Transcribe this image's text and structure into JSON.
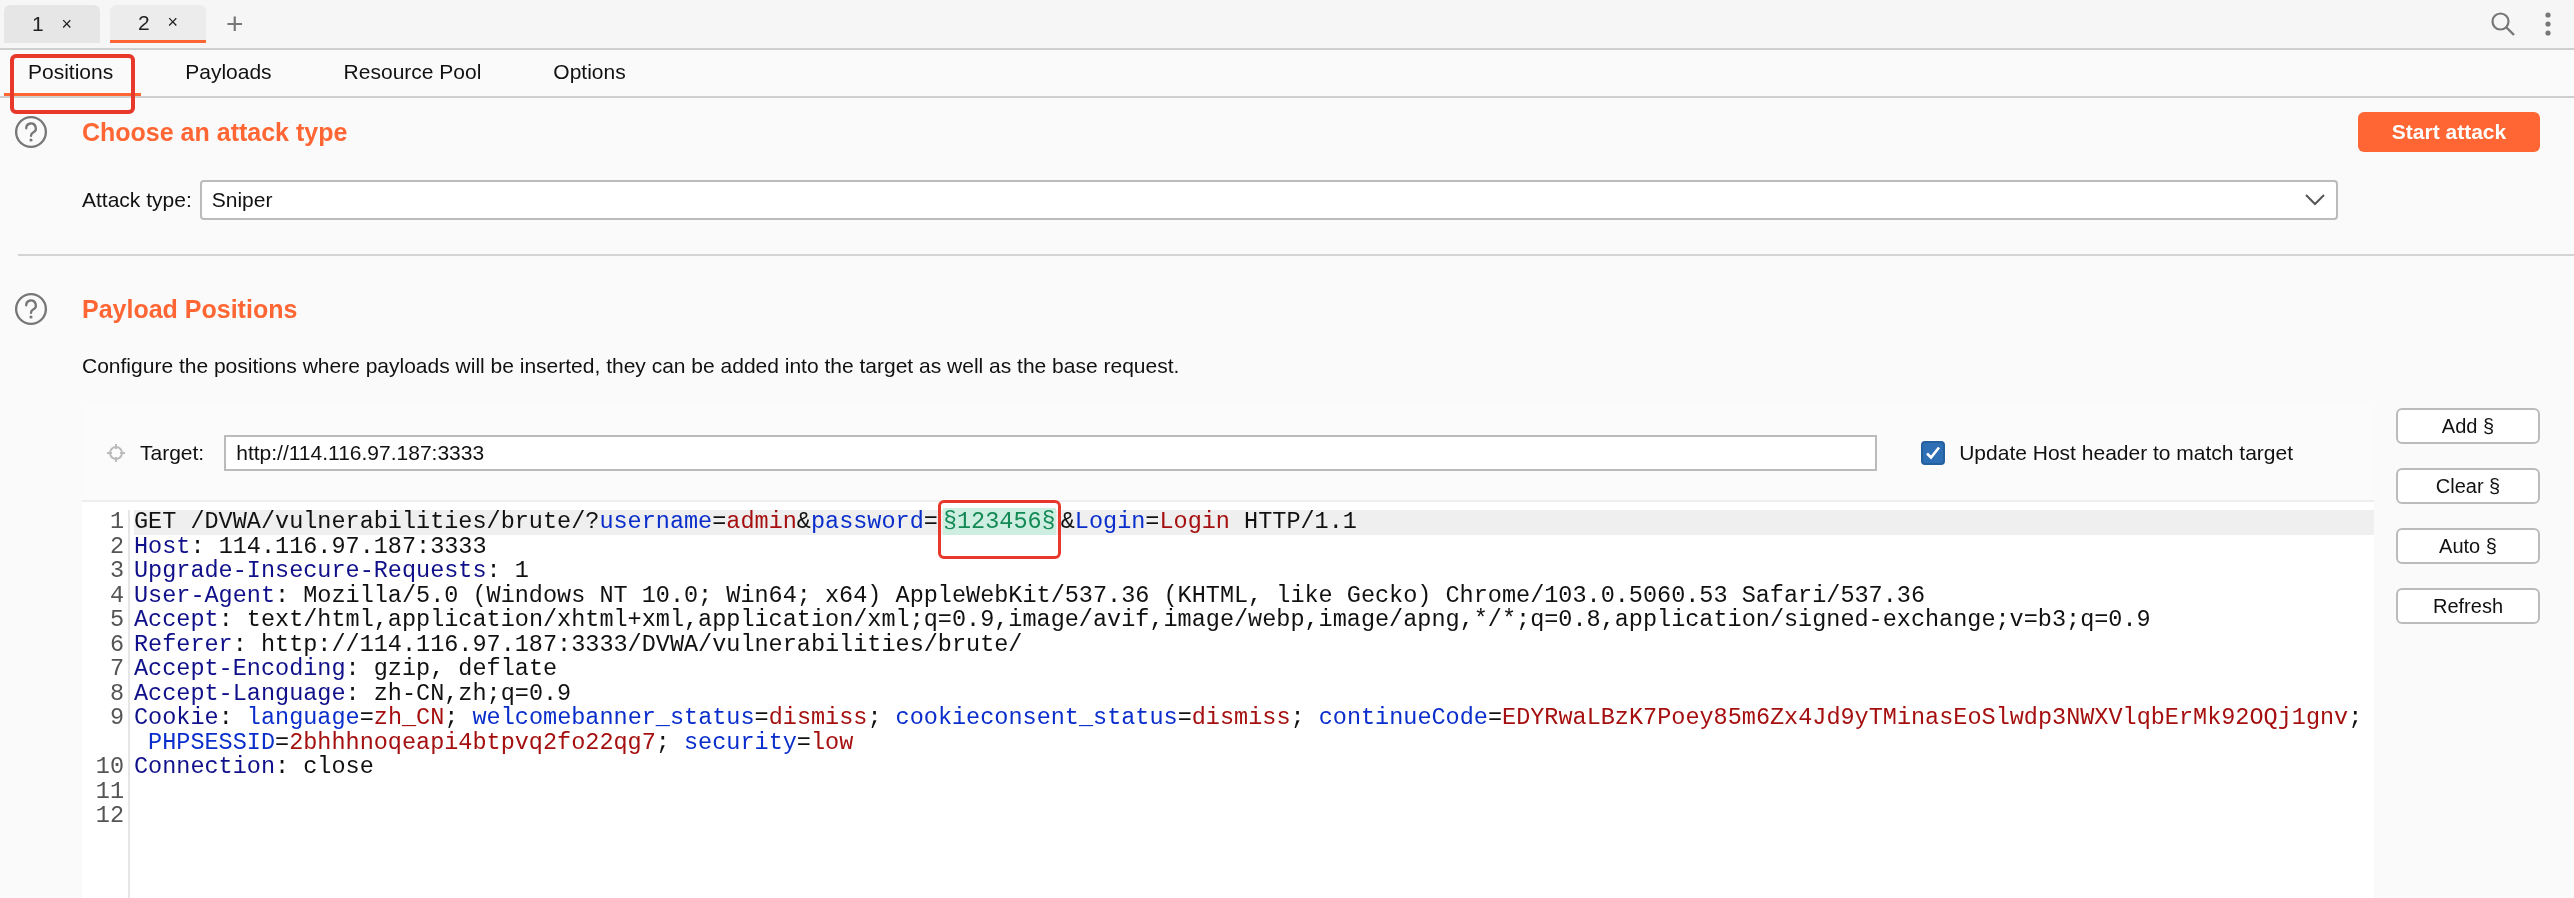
{
  "window_tabs": [
    {
      "label": "1",
      "close": "×",
      "selected": false
    },
    {
      "label": "2",
      "close": "×",
      "selected": true
    }
  ],
  "new_tab": "+",
  "subtabs": [
    {
      "label": "Positions",
      "selected": true,
      "annotated": true
    },
    {
      "label": "Payloads",
      "selected": false,
      "annotated": false
    },
    {
      "label": "Resource Pool",
      "selected": false,
      "annotated": false
    },
    {
      "label": "Options",
      "selected": false,
      "annotated": false
    }
  ],
  "attack_type": {
    "title": "Choose an attack type",
    "button": "Start attack",
    "field_label": "Attack type:",
    "value": "Sniper"
  },
  "payload_positions": {
    "title": "Payload Positions",
    "description": "Configure the positions where payloads will be inserted, they can be added into the target as well as the base request.",
    "target_label": "Target:",
    "target": "http://114.116.97.187:3333",
    "update_host": {
      "label": "Update Host header to match target",
      "checked": true
    },
    "request": {
      "lines": [
        {
          "number": "1",
          "current": true,
          "segments": [
            {
              "kind": "plain",
              "text": "GET /DVWA/vulnerabilities/brute/?"
            },
            {
              "kind": "param",
              "text": "username"
            },
            {
              "kind": "plain",
              "text": "="
            },
            {
              "kind": "value",
              "text": "admin"
            },
            {
              "kind": "plain",
              "text": "&"
            },
            {
              "kind": "param",
              "text": "password"
            },
            {
              "kind": "plain",
              "text": "="
            },
            {
              "kind": "marker",
              "text": "§123456§",
              "annotated": true
            },
            {
              "kind": "plain",
              "text": "&"
            },
            {
              "kind": "param",
              "text": "Login"
            },
            {
              "kind": "plain",
              "text": "="
            },
            {
              "kind": "value",
              "text": "Login"
            },
            {
              "kind": "plain",
              "text": " HTTP/1.1"
            }
          ]
        },
        {
          "number": "2",
          "current": false,
          "segments": [
            {
              "kind": "name",
              "text": "Host"
            },
            {
              "kind": "plain",
              "text": ": 114.116.97.187:3333"
            }
          ]
        },
        {
          "number": "3",
          "current": false,
          "segments": [
            {
              "kind": "name",
              "text": "Upgrade-Insecure-Requests"
            },
            {
              "kind": "plain",
              "text": ": 1"
            }
          ]
        },
        {
          "number": "4",
          "current": false,
          "segments": [
            {
              "kind": "name",
              "text": "User-Agent"
            },
            {
              "kind": "plain",
              "text": ": Mozilla/5.0 (Windows NT 10.0; Win64; x64) AppleWebKit/537.36 (KHTML, like Gecko) Chrome/103.0.5060.53 Safari/537.36"
            }
          ]
        },
        {
          "number": "5",
          "current": false,
          "segments": [
            {
              "kind": "name",
              "text": "Accept"
            },
            {
              "kind": "plain",
              "text": ": text/html,application/xhtml+xml,application/xml;q=0.9,image/avif,image/webp,image/apng,*/*;q=0.8,application/signed-exchange;v=b3;q=0.9"
            }
          ]
        },
        {
          "number": "6",
          "current": false,
          "segments": [
            {
              "kind": "name",
              "text": "Referer"
            },
            {
              "kind": "plain",
              "text": ": http://114.116.97.187:3333/DVWA/vulnerabilities/brute/"
            }
          ]
        },
        {
          "number": "7",
          "current": false,
          "segments": [
            {
              "kind": "name",
              "text": "Accept-Encoding"
            },
            {
              "kind": "plain",
              "text": ": gzip, deflate"
            }
          ]
        },
        {
          "number": "8",
          "current": false,
          "segments": [
            {
              "kind": "name",
              "text": "Accept-Language"
            },
            {
              "kind": "plain",
              "text": ": zh-CN,zh;q=0.9"
            }
          ]
        },
        {
          "number": "9",
          "current": false,
          "segments": [
            {
              "kind": "name",
              "text": "Cookie"
            },
            {
              "kind": "plain",
              "text": ": "
            },
            {
              "kind": "param",
              "text": "language"
            },
            {
              "kind": "plain",
              "text": "="
            },
            {
              "kind": "value",
              "text": "zh_CN"
            },
            {
              "kind": "plain",
              "text": "; "
            },
            {
              "kind": "param",
              "text": "welcomebanner_status"
            },
            {
              "kind": "plain",
              "text": "="
            },
            {
              "kind": "value",
              "text": "dismiss"
            },
            {
              "kind": "plain",
              "text": "; "
            },
            {
              "kind": "param",
              "text": "cookieconsent_status"
            },
            {
              "kind": "plain",
              "text": "="
            },
            {
              "kind": "value",
              "text": "dismiss"
            },
            {
              "kind": "plain",
              "text": "; "
            },
            {
              "kind": "param",
              "text": "continueCode"
            },
            {
              "kind": "plain",
              "text": "="
            },
            {
              "kind": "value",
              "text": "EDYRwaLBzK7Poey85m6Zx4Jd9yTMinasEoSlwdp3NWXVlqbErMk92OQj1gnv"
            },
            {
              "kind": "plain",
              "text": ";"
            }
          ],
          "continuation": {
            "segments": [
              {
                "kind": "param",
                "text": "PHPSESSID"
              },
              {
                "kind": "plain",
                "text": "="
              },
              {
                "kind": "value",
                "text": "2bhhhnoqeapi4btpvq2fo22qg7"
              },
              {
                "kind": "plain",
                "text": "; "
              },
              {
                "kind": "param",
                "text": "security"
              },
              {
                "kind": "plain",
                "text": "="
              },
              {
                "kind": "value",
                "text": "low"
              }
            ]
          }
        },
        {
          "number": "10",
          "current": false,
          "segments": [
            {
              "kind": "name",
              "text": "Connection"
            },
            {
              "kind": "plain",
              "text": ": close"
            }
          ]
        },
        {
          "number": "11",
          "current": false
        },
        {
          "number": "12",
          "current": false
        }
      ]
    },
    "buttons": [
      "Add §",
      "Clear §",
      "Auto §",
      "Refresh"
    ]
  }
}
